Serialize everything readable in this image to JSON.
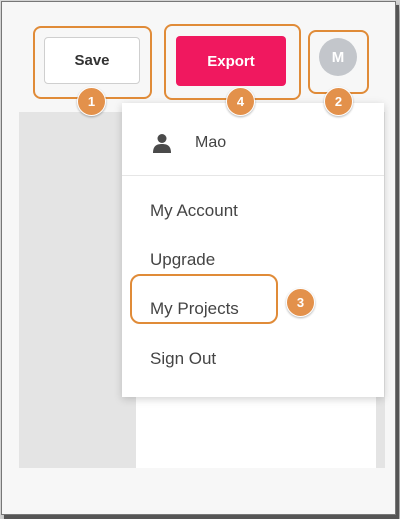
{
  "toolbar": {
    "save_label": "Save",
    "export_label": "Export",
    "avatar_initial": "M"
  },
  "user_menu": {
    "user_name": "Mao",
    "items": [
      {
        "label": "My Account"
      },
      {
        "label": "Upgrade"
      },
      {
        "label": "My Projects"
      },
      {
        "label": "Sign Out"
      }
    ]
  },
  "annotations": {
    "callouts": [
      "1",
      "2",
      "3",
      "4"
    ],
    "highlight_color": "#e08b38",
    "badge_color": "#e3914b"
  },
  "colors": {
    "export_button": "#f0185f",
    "avatar": "#c3c6cb"
  }
}
